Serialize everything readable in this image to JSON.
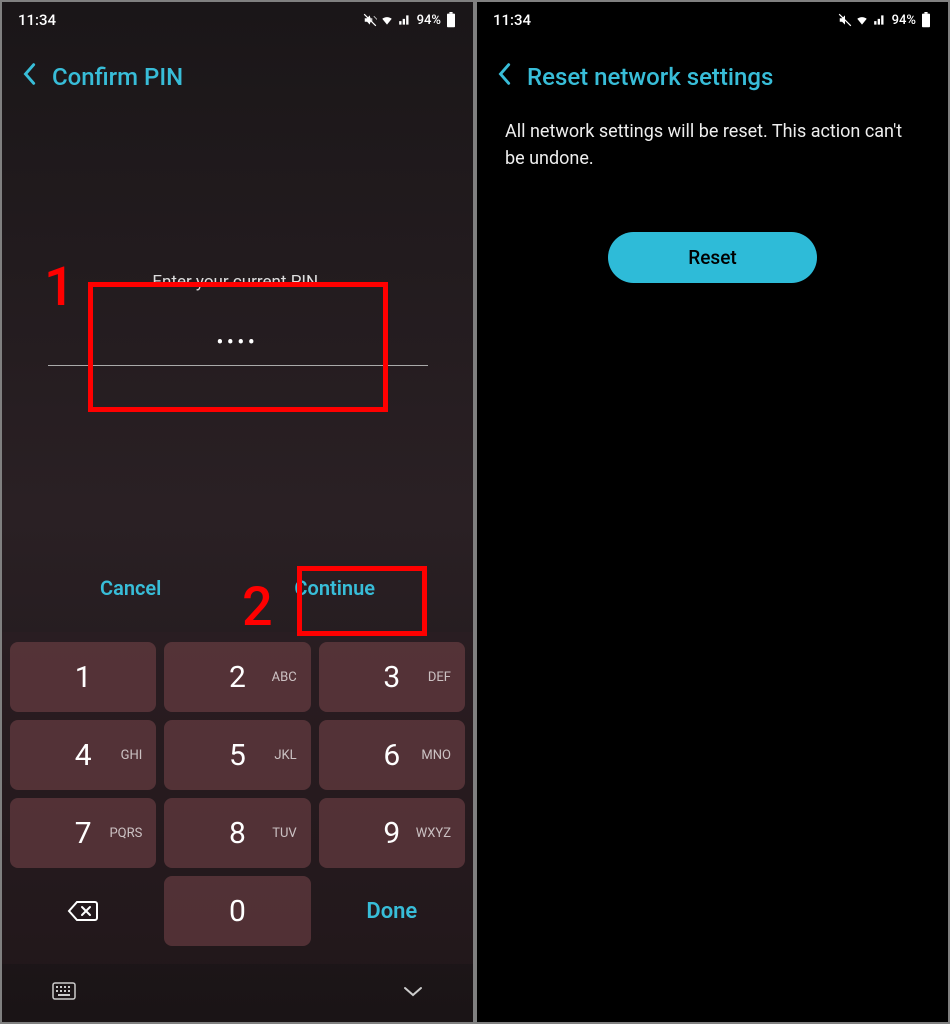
{
  "status": {
    "time": "11:34",
    "battery": "94%"
  },
  "left": {
    "title": "Confirm PIN",
    "prompt": "Enter your current PIN.",
    "masked": "••••",
    "cancel": "Cancel",
    "continue": "Continue",
    "marker1": "1",
    "marker2": "2",
    "keys": [
      [
        {
          "d": "1",
          "l": ""
        },
        {
          "d": "2",
          "l": "ABC"
        },
        {
          "d": "3",
          "l": "DEF"
        }
      ],
      [
        {
          "d": "4",
          "l": "GHI"
        },
        {
          "d": "5",
          "l": "JKL"
        },
        {
          "d": "6",
          "l": "MNO"
        }
      ],
      [
        {
          "d": "7",
          "l": "PQRS"
        },
        {
          "d": "8",
          "l": "TUV"
        },
        {
          "d": "9",
          "l": "WXYZ"
        }
      ]
    ],
    "zero": "0",
    "done": "Done"
  },
  "right": {
    "title": "Reset network settings",
    "body": "All network settings will be reset. This action can't be undone.",
    "reset": "Reset"
  }
}
